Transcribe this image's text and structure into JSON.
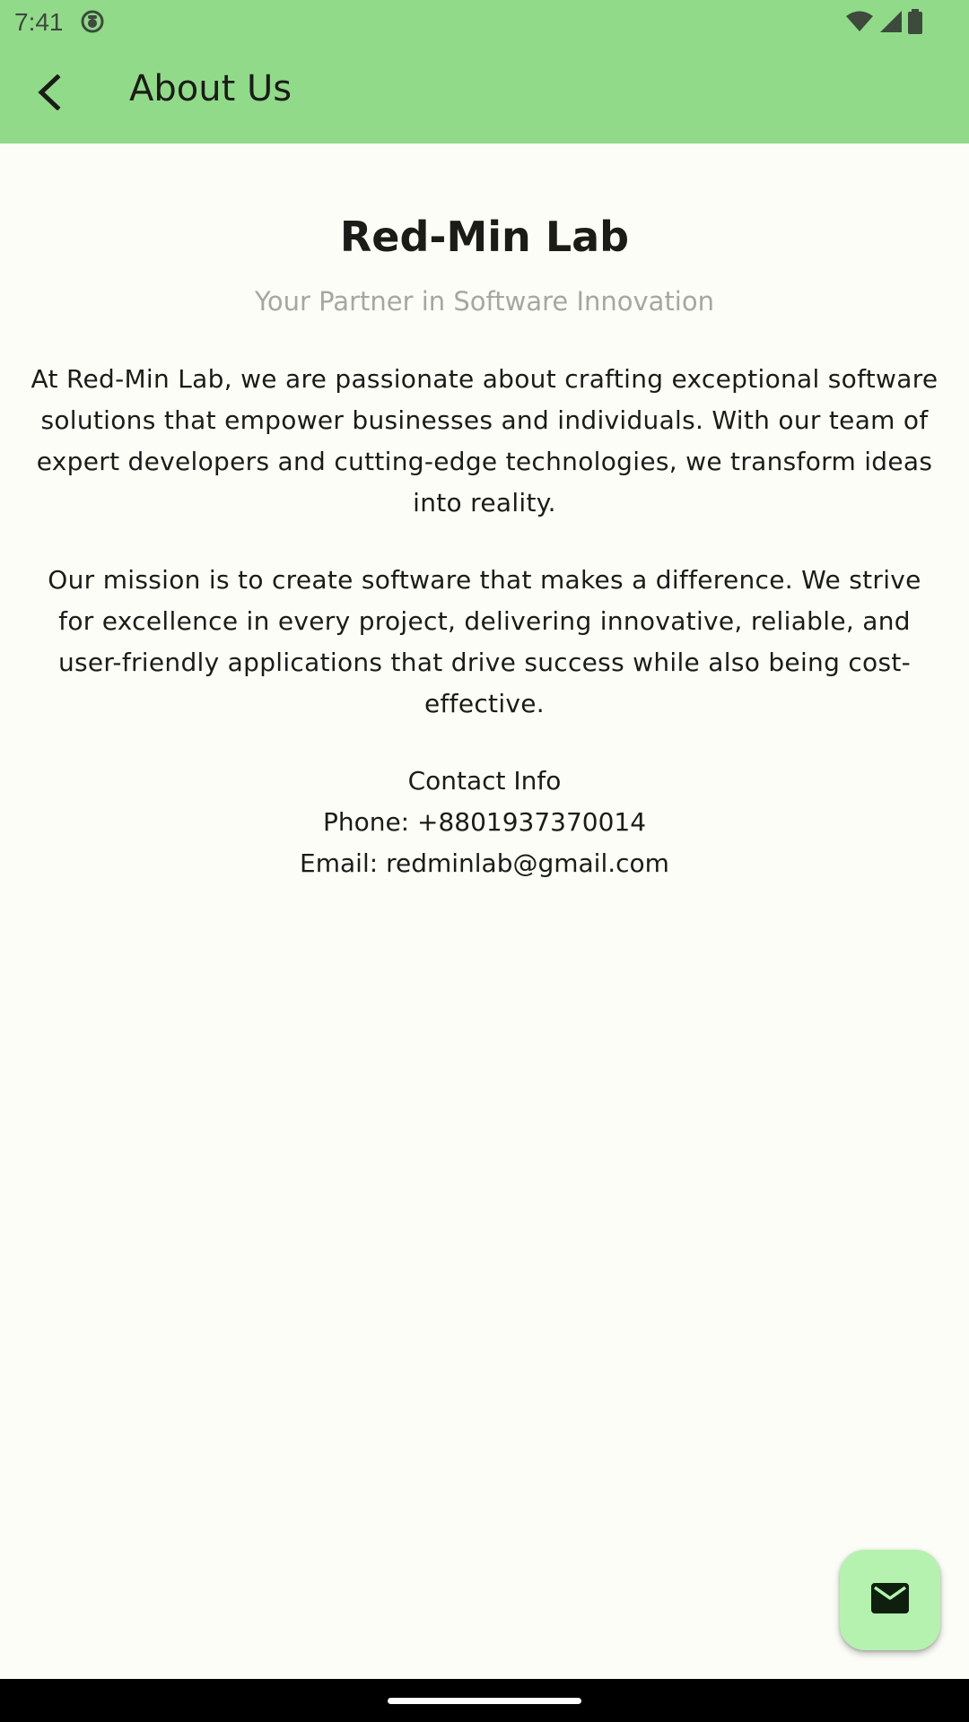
{
  "status_bar": {
    "time": "7:41",
    "icons": [
      "notification-app-icon",
      "wifi-icon",
      "cell-signal-icon",
      "battery-icon"
    ]
  },
  "app_bar": {
    "title": "About Us",
    "back_icon": "arrow-back-icon"
  },
  "about": {
    "company_name": "Red-Min Lab",
    "tagline": "Your Partner in Software Innovation",
    "paragraph_1": "At Red-Min Lab, we are passionate about crafting exceptional software solutions that empower businesses and individuals. With our team of expert developers and cutting-edge technologies, we transform ideas into reality.",
    "paragraph_2": "Our mission is to create software that makes a difference. We strive for excellence in every project, delivering innovative, reliable, and user-friendly applications that drive success while also being cost-effective."
  },
  "contact": {
    "heading": "Contact Info",
    "phone": "Phone: +8801937370014",
    "email": "Email: redminlab@gmail.com"
  },
  "fab": {
    "icon": "mail-icon"
  },
  "colors": {
    "app_bar": "#91da89",
    "background": "#fcfdf7",
    "fab": "#b5f2b0",
    "tagline": "#a4a8a1"
  }
}
